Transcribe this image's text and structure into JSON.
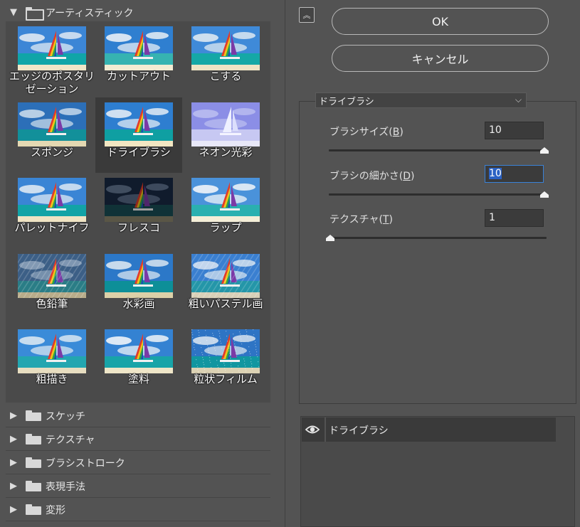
{
  "gallery": {
    "open_category": "アーティスティック",
    "thumbnails": [
      {
        "label": "エッジのポスタリ\nゼーション",
        "style": "poster"
      },
      {
        "label": "カットアウト",
        "style": "cutout"
      },
      {
        "label": "こする",
        "style": "smudge"
      },
      {
        "label": "スポンジ",
        "style": "sponge"
      },
      {
        "label": "ドライブラシ",
        "style": "drybrush"
      },
      {
        "label": "ネオン光彩",
        "style": "neon"
      },
      {
        "label": "パレットナイフ",
        "style": "palette"
      },
      {
        "label": "フレスコ",
        "style": "fresco"
      },
      {
        "label": "ラップ",
        "style": "wrap"
      },
      {
        "label": "色鉛筆",
        "style": "pencil"
      },
      {
        "label": "水彩画",
        "style": "watercolor"
      },
      {
        "label": "粗いパステル画",
        "style": "pastel"
      },
      {
        "label": "粗描き",
        "style": "sketch"
      },
      {
        "label": "塗料",
        "style": "paint"
      },
      {
        "label": "粒状フィルム",
        "style": "grain"
      }
    ],
    "selected_thumbnail": "ドライブラシ",
    "categories": [
      "スケッチ",
      "テクスチャ",
      "ブラシストローク",
      "表現手法",
      "変形"
    ]
  },
  "buttons": {
    "ok": "OK",
    "cancel": "キャンセル",
    "collapse_icon": "double-chevron-up-icon"
  },
  "settings": {
    "filter_select": "ドライブラシ",
    "params": [
      {
        "label": "ブラシサイズ(",
        "key": "B",
        "value": "10",
        "slider_fraction": 1.0
      },
      {
        "label": "ブラシの細かさ(",
        "key": "D",
        "value": "10",
        "slider_fraction": 1.0
      },
      {
        "label": "テクスチャ(",
        "key": "T",
        "value": "1",
        "slider_fraction": 0.0
      }
    ]
  },
  "layers": {
    "items": [
      {
        "name": "ドライブラシ",
        "visible": true
      }
    ]
  },
  "colors": {
    "background": "#535353",
    "focus": "#3a82d8",
    "selection": "#2b62c4"
  }
}
